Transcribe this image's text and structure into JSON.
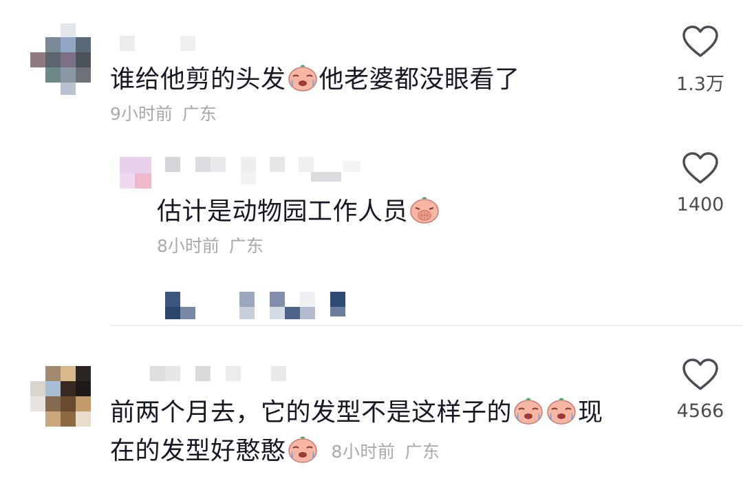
{
  "colors": {
    "text": "#161823",
    "meta": "#a8a9ad",
    "like_icon": "#4b4c52",
    "emoji_face": "#f7b5a4",
    "emoji_leaf": "#3aa36a"
  },
  "comments": [
    {
      "username": "",
      "text_before_emoji": "谁给他剪的头发",
      "emoji": "crying-face-emoji",
      "text_after_emoji": "他老婆都没眼看了",
      "time": "9小时前",
      "region": "广东",
      "likes": "1.3万"
    },
    {
      "username": "",
      "text_before_emoji": "估计是动物园工作人员",
      "emoji": "covering-face-emoji",
      "time": "8小时前",
      "region": "广东",
      "likes": "1400"
    },
    {
      "username": "",
      "line1_before": "前两个月去，它的发型不是这样子的",
      "emoji": "crying-face-emoji",
      "line1_after": "现",
      "line2_before": "在的发型好憨憨",
      "time": "8小时前",
      "region": "广东",
      "likes": "4566"
    }
  ],
  "icons": {
    "like": "heart-outline-icon"
  }
}
